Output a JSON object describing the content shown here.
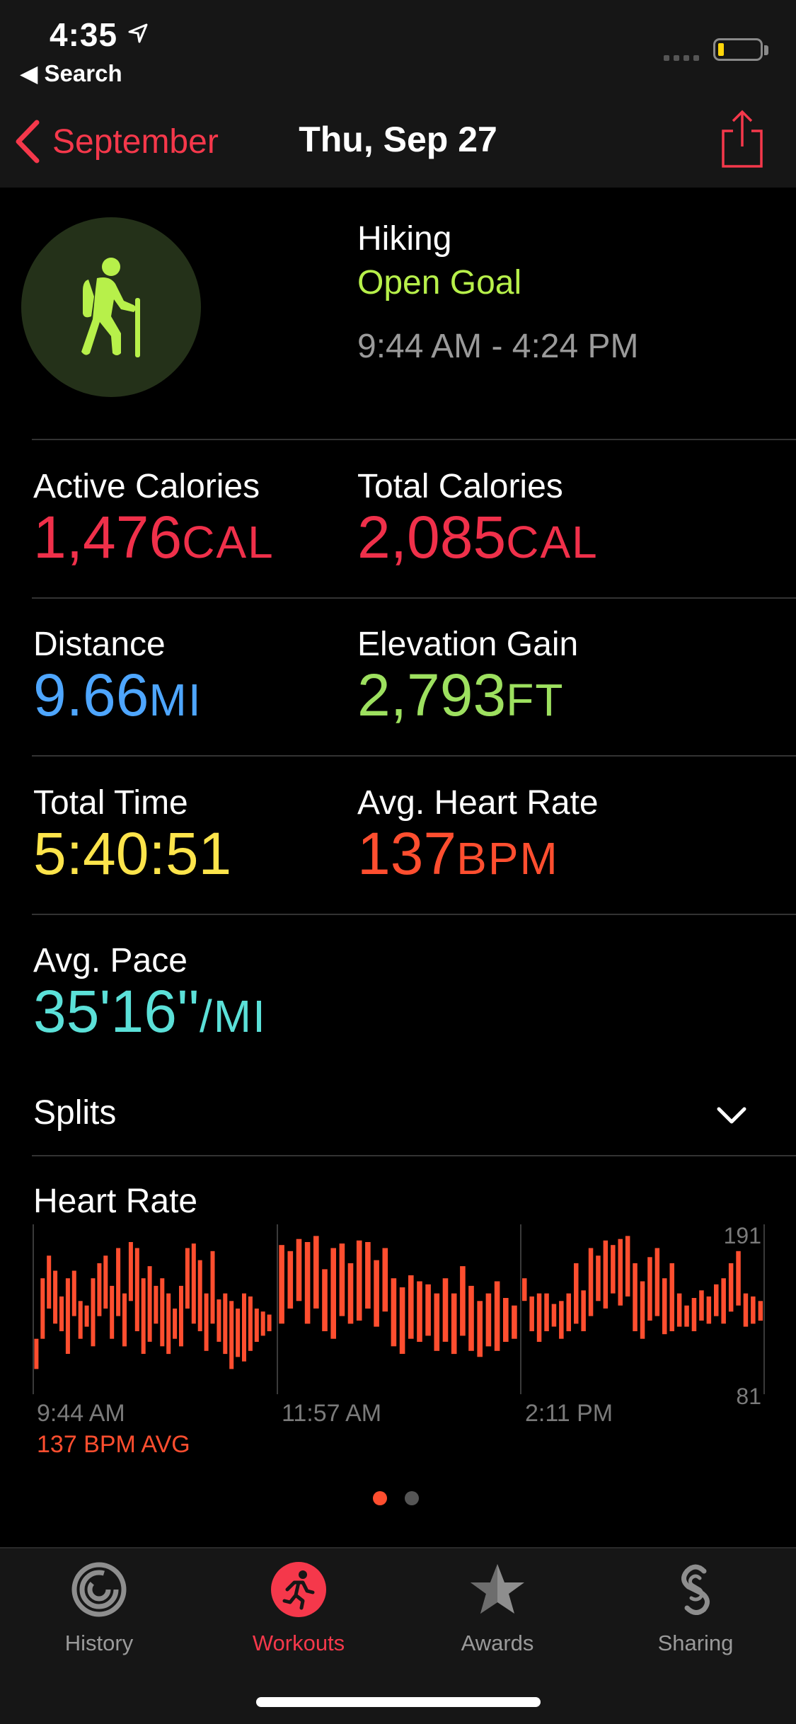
{
  "status_bar": {
    "time": "4:35",
    "back_app": "◀ Search"
  },
  "nav": {
    "back_label": "September",
    "title": "Thu, Sep 27"
  },
  "workout": {
    "icon": "hiking-icon",
    "type": "Hiking",
    "goal": "Open Goal",
    "time_range": "9:44 AM - 4:24 PM"
  },
  "metrics": {
    "active_calories": {
      "label": "Active Calories",
      "value": "1,476",
      "unit": "CAL",
      "color": "#f0304a"
    },
    "total_calories": {
      "label": "Total Calories",
      "value": "2,085",
      "unit": "CAL",
      "color": "#f0304a"
    },
    "distance": {
      "label": "Distance",
      "value": "9.66",
      "unit": "MI",
      "color": "#4ea6ff"
    },
    "elevation_gain": {
      "label": "Elevation Gain",
      "value": "2,793",
      "unit": "FT",
      "color": "#9de05f"
    },
    "total_time": {
      "label": "Total Time",
      "value": "5:40:51",
      "unit": "",
      "color": "#fde44b"
    },
    "avg_heart_rate": {
      "label": "Avg. Heart Rate",
      "value": "137",
      "unit": "BPM",
      "color": "#ff4e2f"
    },
    "avg_pace": {
      "label": "Avg. Pace",
      "value": "35'16''",
      "unit": "/MI",
      "color": "#5be0d8"
    }
  },
  "splits": {
    "label": "Splits"
  },
  "heart_rate": {
    "title": "Heart Rate",
    "y_max_label": "191",
    "y_min_label": "81",
    "x_labels": [
      "9:44 AM",
      "11:57 AM",
      "2:11 PM"
    ],
    "avg_label": "137 BPM AVG",
    "color": "#ff4e2f"
  },
  "chart_data": {
    "type": "bar",
    "title": "Heart Rate",
    "ylim": [
      81,
      191
    ],
    "x_tick_labels": [
      "9:44 AM",
      "11:57 AM",
      "2:11 PM"
    ],
    "series": [
      {
        "name": "",
        "segments": [
          {
            "segment": 1,
            "ranges": [
              [
                100,
                120
              ],
              [
                120,
                160
              ],
              [
                140,
                175
              ],
              [
                130,
                165
              ],
              [
                125,
                148
              ],
              [
                110,
                160
              ],
              [
                135,
                165
              ],
              [
                120,
                145
              ],
              [
                128,
                142
              ],
              [
                115,
                160
              ],
              [
                135,
                170
              ],
              [
                140,
                175
              ],
              [
                120,
                155
              ],
              [
                135,
                180
              ],
              [
                115,
                150
              ],
              [
                145,
                184
              ],
              [
                125,
                180
              ],
              [
                110,
                160
              ],
              [
                118,
                168
              ],
              [
                130,
                155
              ],
              [
                115,
                160
              ],
              [
                110,
                150
              ],
              [
                120,
                140
              ],
              [
                115,
                155
              ],
              [
                140,
                180
              ],
              [
                130,
                183
              ],
              [
                125,
                172
              ],
              [
                112,
                150
              ],
              [
                130,
                178
              ],
              [
                118,
                146
              ],
              [
                110,
                150
              ],
              [
                100,
                145
              ],
              [
                108,
                140
              ],
              [
                105,
                150
              ],
              [
                112,
                148
              ],
              [
                118,
                140
              ],
              [
                122,
                138
              ],
              [
                125,
                136
              ]
            ]
          },
          {
            "segment": 2,
            "ranges": [
              [
                130,
                182
              ],
              [
                140,
                178
              ],
              [
                145,
                186
              ],
              [
                130,
                184
              ],
              [
                140,
                188
              ],
              [
                125,
                166
              ],
              [
                120,
                180
              ],
              [
                135,
                183
              ],
              [
                130,
                170
              ],
              [
                132,
                185
              ],
              [
                140,
                184
              ],
              [
                128,
                172
              ],
              [
                138,
                180
              ],
              [
                115,
                160
              ],
              [
                110,
                154
              ],
              [
                120,
                162
              ],
              [
                118,
                158
              ],
              [
                122,
                156
              ],
              [
                112,
                150
              ],
              [
                118,
                160
              ],
              [
                110,
                150
              ],
              [
                122,
                168
              ],
              [
                112,
                155
              ],
              [
                108,
                145
              ],
              [
                115,
                150
              ],
              [
                112,
                158
              ],
              [
                118,
                147
              ],
              [
                120,
                142
              ]
            ]
          },
          {
            "segment": 3,
            "ranges": [
              [
                145,
                160
              ],
              [
                125,
                148
              ],
              [
                118,
                150
              ],
              [
                125,
                150
              ],
              [
                128,
                143
              ],
              [
                120,
                145
              ],
              [
                125,
                150
              ],
              [
                130,
                170
              ],
              [
                125,
                152
              ],
              [
                135,
                180
              ],
              [
                145,
                175
              ],
              [
                140,
                185
              ],
              [
                150,
                182
              ],
              [
                142,
                186
              ],
              [
                148,
                188
              ],
              [
                125,
                170
              ],
              [
                120,
                158
              ],
              [
                132,
                174
              ],
              [
                135,
                180
              ],
              [
                123,
                160
              ],
              [
                125,
                170
              ],
              [
                128,
                150
              ],
              [
                128,
                142
              ],
              [
                125,
                147
              ],
              [
                132,
                152
              ],
              [
                130,
                148
              ],
              [
                135,
                156
              ],
              [
                130,
                160
              ],
              [
                138,
                170
              ],
              [
                142,
                178
              ],
              [
                128,
                150
              ],
              [
                130,
                148
              ],
              [
                132,
                145
              ]
            ]
          }
        ]
      }
    ]
  },
  "pager": {
    "active": 0,
    "count": 2
  },
  "tabs": [
    {
      "label": "History",
      "icon": "history-rings-icon"
    },
    {
      "label": "Workouts",
      "icon": "running-figure-icon"
    },
    {
      "label": "Awards",
      "icon": "award-star-icon"
    },
    {
      "label": "Sharing",
      "icon": "sharing-icon"
    }
  ]
}
